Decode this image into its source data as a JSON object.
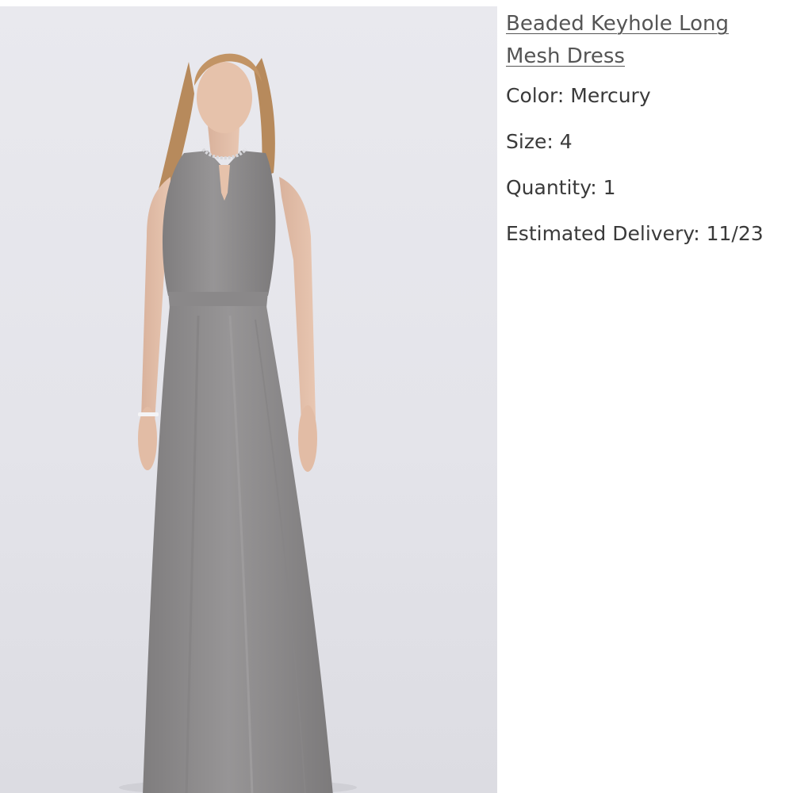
{
  "product": {
    "title": "Beaded Keyhole Long Mesh Dress",
    "image_alt": "Model wearing grey halter maxi dress",
    "attributes": [
      {
        "label": "Color:",
        "value": "Mercury"
      },
      {
        "label": "Size:",
        "value": "4"
      },
      {
        "label": "Quantity:",
        "value": "1"
      },
      {
        "label": "Estimated Delivery:",
        "value": "11/23"
      }
    ]
  },
  "colors": {
    "link": "#555555",
    "text": "#3a3a3a",
    "dress": "#8f8d8e",
    "background": "#e6e6eb"
  }
}
